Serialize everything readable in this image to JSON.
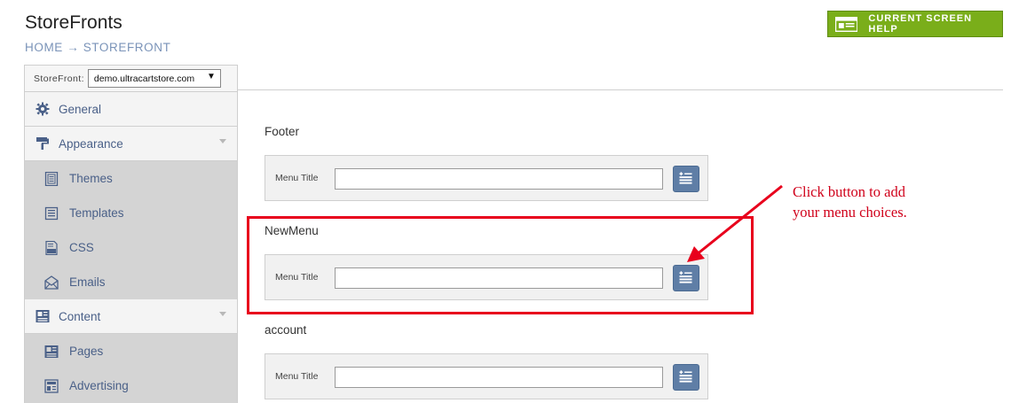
{
  "header": {
    "title": "StoreFronts",
    "breadcrumb": "HOME → STOREFRONT",
    "help_button_label": "CURRENT SCREEN HELP"
  },
  "sidebar": {
    "storefront_label": "StoreFront:",
    "storefront_value": "demo.ultracartstore.com",
    "items": [
      {
        "label": "General",
        "icon": "gear-icon",
        "level": "top"
      },
      {
        "label": "Appearance",
        "icon": "paint-roller-icon",
        "level": "top",
        "expandable": true
      },
      {
        "label": "Themes",
        "icon": "themes-icon",
        "level": "sub"
      },
      {
        "label": "Templates",
        "icon": "templates-icon",
        "level": "sub"
      },
      {
        "label": "CSS",
        "icon": "css-file-icon",
        "level": "sub"
      },
      {
        "label": "Emails",
        "icon": "email-icon",
        "level": "sub"
      },
      {
        "label": "Content",
        "icon": "content-icon",
        "level": "top",
        "expandable": true
      },
      {
        "label": "Pages",
        "icon": "pages-icon",
        "level": "sub"
      },
      {
        "label": "Advertising",
        "icon": "advertising-icon",
        "level": "sub"
      }
    ]
  },
  "menus": [
    {
      "name": "Footer",
      "field_label": "Menu Title",
      "value": ""
    },
    {
      "name": "NewMenu",
      "field_label": "Menu Title",
      "value": ""
    },
    {
      "name": "account",
      "field_label": "Menu Title",
      "value": ""
    }
  ],
  "annotation": {
    "line1": "Click button to add",
    "line2": "your menu choices."
  },
  "colors": {
    "help_green": "#7aae1a",
    "nav_text": "#4a6088",
    "add_button": "#5f7ea6",
    "annotation_red": "#e8001c"
  }
}
